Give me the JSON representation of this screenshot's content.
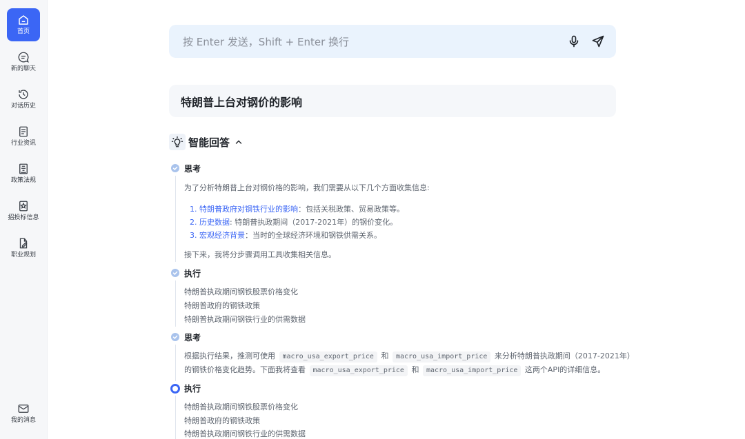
{
  "sidebar": {
    "items": [
      {
        "label": "首页",
        "icon": "home-icon"
      },
      {
        "label": "新的聊天",
        "icon": "chat-icon"
      },
      {
        "label": "对话历史",
        "icon": "history-icon"
      },
      {
        "label": "行业资讯",
        "icon": "news-icon"
      },
      {
        "label": "政策法规",
        "icon": "policy-icon"
      },
      {
        "label": "招投标信息",
        "icon": "bid-icon"
      },
      {
        "label": "职业规划",
        "icon": "career-icon"
      }
    ],
    "messages": {
      "label": "我的消息",
      "icon": "mail-icon"
    }
  },
  "search": {
    "placeholder": "按 Enter 发送，Shift + Enter 换行",
    "mic_icon": "mic-icon",
    "send_icon": "send-icon"
  },
  "question": "特朗普上台对钢价的影响",
  "answer": {
    "title": "智能回答",
    "steps": [
      {
        "title": "思考",
        "intro": "为了分析特朗普上台对钢价格的影响，我们需要从以下几个方面收集信息:",
        "items": [
          {
            "num": "1.",
            "head": "特朗普政府对钢铁行业的影响",
            "rest": "：包括关税政策、贸易政策等。"
          },
          {
            "num": "2.",
            "head": "历史数据",
            "rest": ": 特朗普执政期间（2017-2021年）的钢价变化。"
          },
          {
            "num": "3.",
            "head": "宏观经济背景",
            "rest": "：当时的全球经济环境和钢铁供需关系。"
          }
        ],
        "outro": "接下来，我将分步骤调用工具收集相关信息。"
      },
      {
        "title": "执行",
        "lines": [
          "特朗普执政期间钢铁股票价格变化",
          "特朗普政府的钢铁政策",
          "特朗普执政期间钢铁行业的供需数据"
        ]
      },
      {
        "title": "思考",
        "line1": {
          "a": "根据执行结果，推测可使用",
          "code1": "macro_usa_export_price",
          "b": "和",
          "code2": "macro_usa_import_price",
          "c": "来分析特朗普执政期间（2017-2021年）"
        },
        "line2": {
          "a": "的钢铁价格变化趋势。下面我将查看",
          "code1": "macro_usa_export_price",
          "b": "和",
          "code2": "macro_usa_import_price",
          "c": "这两个API的详细信息。"
        }
      },
      {
        "title": "执行",
        "lines": [
          "特朗普执政期间钢铁股票价格变化",
          "特朗普政府的钢铁政策",
          "特朗普执政期间钢铁行业的供需数据"
        ]
      }
    ]
  },
  "colors": {
    "accent": "#3b66f5",
    "search_bg": "#eaf3fd",
    "sidebar_bg": "#f6f7f9"
  }
}
